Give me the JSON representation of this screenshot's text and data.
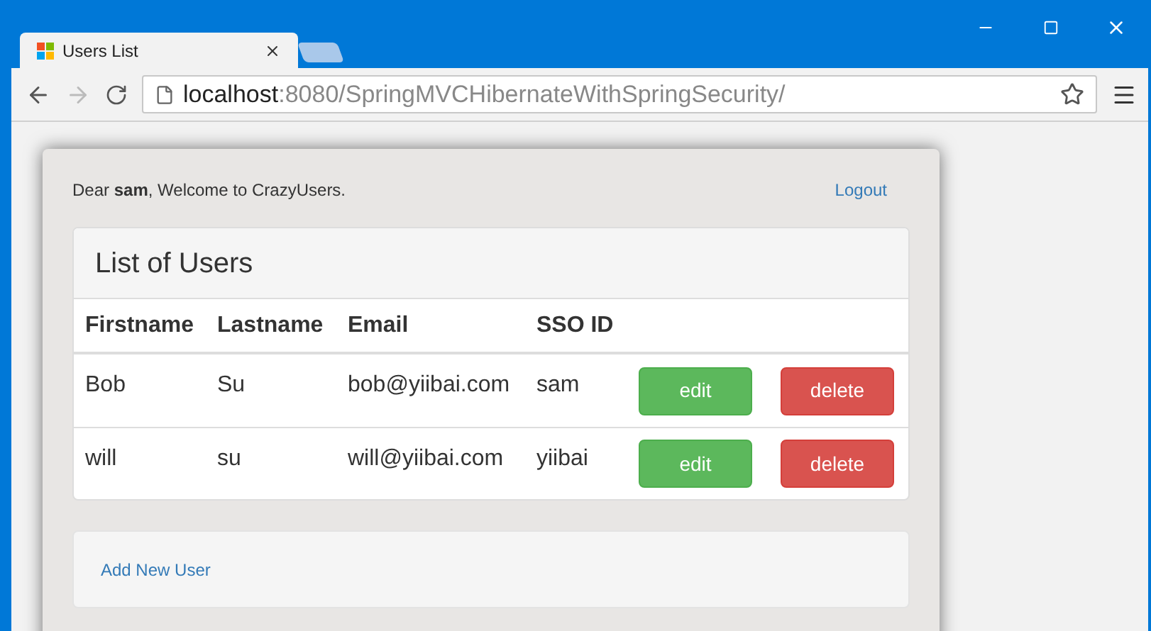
{
  "browser": {
    "tab_title": "Users List",
    "url_host": "localhost",
    "url_path": ":8080/SpringMVCHibernateWithSpringSecurity/"
  },
  "greeting": "Dear **sam**, Welcome to CrazyUsers.",
  "logout": "Logout",
  "panel": {
    "title": "List of Users",
    "columns": [
      "Firstname",
      "Lastname",
      "Email",
      "SSO ID"
    ],
    "rows": [
      {
        "cells": [
          "Bob",
          "Su",
          "bob@yiibai.com",
          "sam"
        ],
        "actions": [
          "edit",
          "delete"
        ]
      },
      {
        "cells": [
          "will",
          "su",
          "will@yiibai.com",
          "yiibai"
        ],
        "actions": [
          "edit",
          "delete"
        ]
      }
    ]
  },
  "add_link": "Add New User"
}
